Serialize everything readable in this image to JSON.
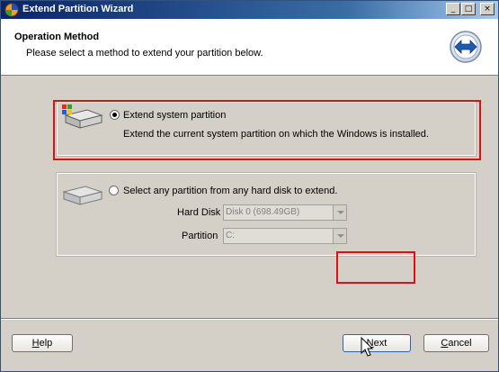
{
  "window": {
    "title": "Extend Partition Wizard",
    "controls": {
      "minimize": "_",
      "maximize": "□",
      "close": "×"
    }
  },
  "header": {
    "title": "Operation Method",
    "subtitle": "Please select a method to extend your partition below."
  },
  "options": [
    {
      "label": "Extend system partition",
      "description": "Extend the current system partition on which the Windows is installed.",
      "selected": true
    },
    {
      "label": "Select any partition from any hard disk to extend.",
      "selected": false,
      "hard_disk_label": "Hard Disk",
      "hard_disk_value": "Disk 0 (698.49GB)",
      "partition_label": "Partition",
      "partition_value": "C:"
    }
  ],
  "buttons": {
    "help_first": "H",
    "help_rest": "elp",
    "next_first": "N",
    "next_rest": "ext",
    "cancel_first": "C",
    "cancel_rest": "ancel"
  },
  "colors": {
    "highlight": "#e01010",
    "titlebar": "#0a246a"
  },
  "icons": [
    "app-icon",
    "wizard-arrows-icon",
    "system-disk-icon",
    "hard-disk-icon",
    "mouse-cursor-icon"
  ]
}
